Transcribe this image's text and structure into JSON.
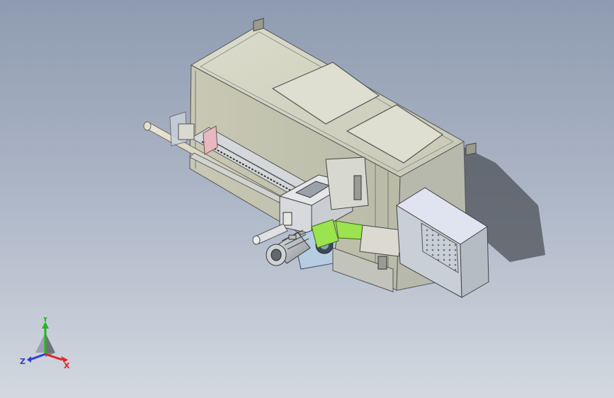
{
  "triad": {
    "x_label": "X",
    "y_label": "Y",
    "z_label": "Z",
    "x_color": "#e0261f",
    "y_color": "#22b822",
    "z_color": "#2a3fd8"
  },
  "model": {
    "cabinet_color": "#d2d2c2",
    "side_panel_color": "#c9cfd6",
    "green_part_color": "#9be34f",
    "blue_housing_color": "#b4cde0",
    "pink_part_color": "#e7b8bf"
  }
}
